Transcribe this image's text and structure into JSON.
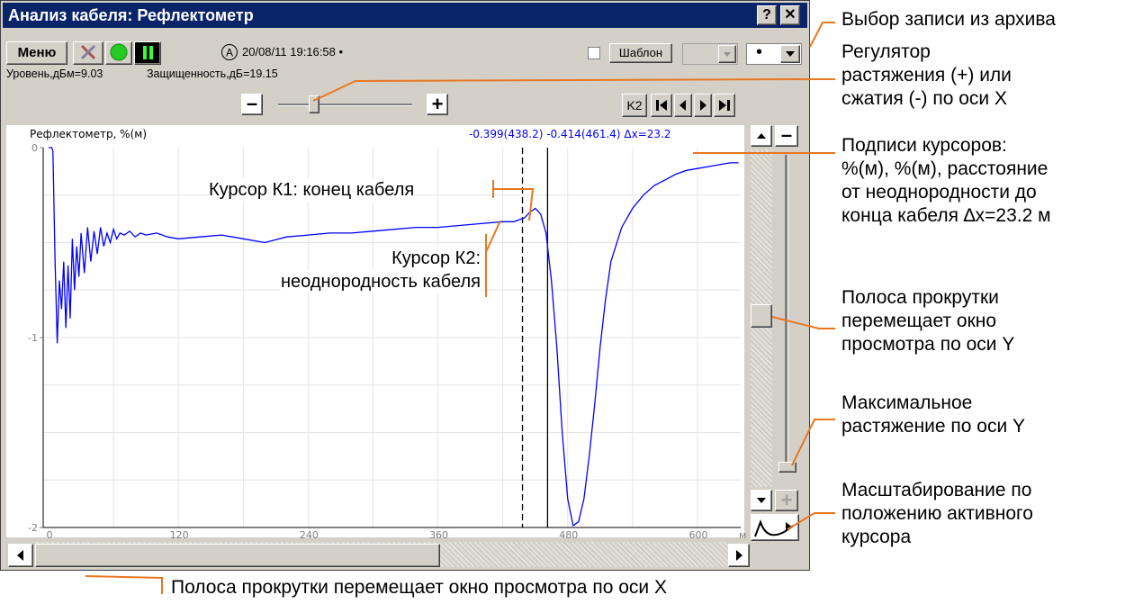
{
  "window": {
    "title": "Анализ кабеля: Рефлектометр",
    "help_label": "?",
    "close_label": "✕"
  },
  "toolbar": {
    "menu_label": "Меню",
    "mode_letter": "A",
    "datetime": "20/08/11 19:16:58 •",
    "template_label": "Шаблон",
    "archive_dot": "•"
  },
  "status": {
    "level": "Уровень,дБм=9.03",
    "protection": "Защищенность,дБ=19.15"
  },
  "zoom_x": {
    "minus_label": "–",
    "plus_label": "+",
    "level": 0.25
  },
  "nav": {
    "k2_label": "K2"
  },
  "y_zoom": {
    "minus_label": "–",
    "plus_label": "+"
  },
  "chart_data": {
    "type": "line",
    "title": "Рефлектометр, %(м)",
    "cursor_readout": "-0.399(438.2)  -0.414(461.4)  Δx=23.2",
    "xlabel": "м",
    "ylabel": "",
    "xlim": [
      -5,
      640
    ],
    "ylim": [
      -2,
      0
    ],
    "x_ticks": [
      "0",
      "120",
      "240",
      "360",
      "480",
      "600"
    ],
    "x_tick_values": [
      0,
      120,
      240,
      360,
      480,
      600
    ],
    "y_ticks": [
      "0",
      "-1",
      "-2"
    ],
    "y_tick_values": [
      0,
      -1,
      -2
    ],
    "grid": true,
    "line_color": "#0000ff",
    "cursors": [
      {
        "name": "K2",
        "x": 438.2,
        "style": "dashed"
      },
      {
        "name": "K1",
        "x": 461.4,
        "style": "solid"
      }
    ],
    "series": [
      {
        "x": [
          0,
          3,
          4,
          6,
          8,
          10,
          12,
          14,
          16,
          18,
          20,
          22,
          24,
          26,
          28,
          30,
          33,
          36,
          39,
          42,
          45,
          48,
          51,
          54,
          57,
          60,
          63,
          66,
          70,
          75,
          80,
          85,
          90,
          100,
          110,
          120,
          140,
          160,
          180,
          200,
          220,
          240,
          260,
          280,
          300,
          320,
          340,
          360,
          380,
          400,
          420,
          430,
          440,
          445,
          450,
          455,
          460,
          465,
          470,
          475,
          480,
          485,
          490,
          495,
          500,
          505,
          510,
          515,
          520,
          530,
          540,
          550,
          560,
          570,
          580,
          590,
          600,
          610,
          620,
          630,
          638
        ],
        "y": [
          0,
          0,
          -0.02,
          -0.6,
          -1.03,
          -0.7,
          -0.85,
          -0.6,
          -0.95,
          -0.62,
          -0.9,
          -0.48,
          -0.75,
          -0.52,
          -0.68,
          -0.45,
          -0.66,
          -0.42,
          -0.6,
          -0.44,
          -0.56,
          -0.42,
          -0.52,
          -0.45,
          -0.5,
          -0.43,
          -0.48,
          -0.45,
          -0.46,
          -0.44,
          -0.47,
          -0.45,
          -0.46,
          -0.45,
          -0.47,
          -0.48,
          -0.47,
          -0.46,
          -0.48,
          -0.5,
          -0.47,
          -0.46,
          -0.45,
          -0.45,
          -0.44,
          -0.43,
          -0.42,
          -0.42,
          -0.41,
          -0.4,
          -0.39,
          -0.39,
          -0.37,
          -0.34,
          -0.32,
          -0.35,
          -0.45,
          -0.7,
          -1.05,
          -1.5,
          -1.85,
          -1.99,
          -1.97,
          -1.85,
          -1.62,
          -1.35,
          -1.05,
          -0.8,
          -0.6,
          -0.42,
          -0.32,
          -0.25,
          -0.2,
          -0.17,
          -0.14,
          -0.12,
          -0.11,
          -0.1,
          -0.09,
          -0.08,
          -0.08
        ]
      }
    ]
  },
  "callouts": {
    "archive": "Выбор записи из архива",
    "stretch_x": [
      "Регулятор",
      "растяжения (+) или",
      "сжатия (-) по оси X"
    ],
    "cursor_labels": [
      "Подписи курсоров:",
      "%(м), %(м), расстояние",
      "от неоднородности до",
      "конца кабеля ∆x=23.2 м"
    ],
    "scroll_y": [
      "Полоса прокрутки",
      "перемещает окно",
      "просмотра по оси Y"
    ],
    "max_stretch_y": [
      "Максимальное",
      "растяжение по оси Y"
    ],
    "scale_by_cursor": [
      "Масштабирование по",
      "положению активного",
      "курсора"
    ],
    "scroll_x": "Полоса прокрутки перемещает окно просмотра по оси X",
    "cursor_k1": "Курсор К1: конец кабеля",
    "cursor_k2": [
      "Курсор К2:",
      "неоднородность кабеля"
    ]
  },
  "colors": {
    "titlebar": "#0a246a",
    "leader_lines": "#e87722",
    "trace": "#0000ff"
  }
}
